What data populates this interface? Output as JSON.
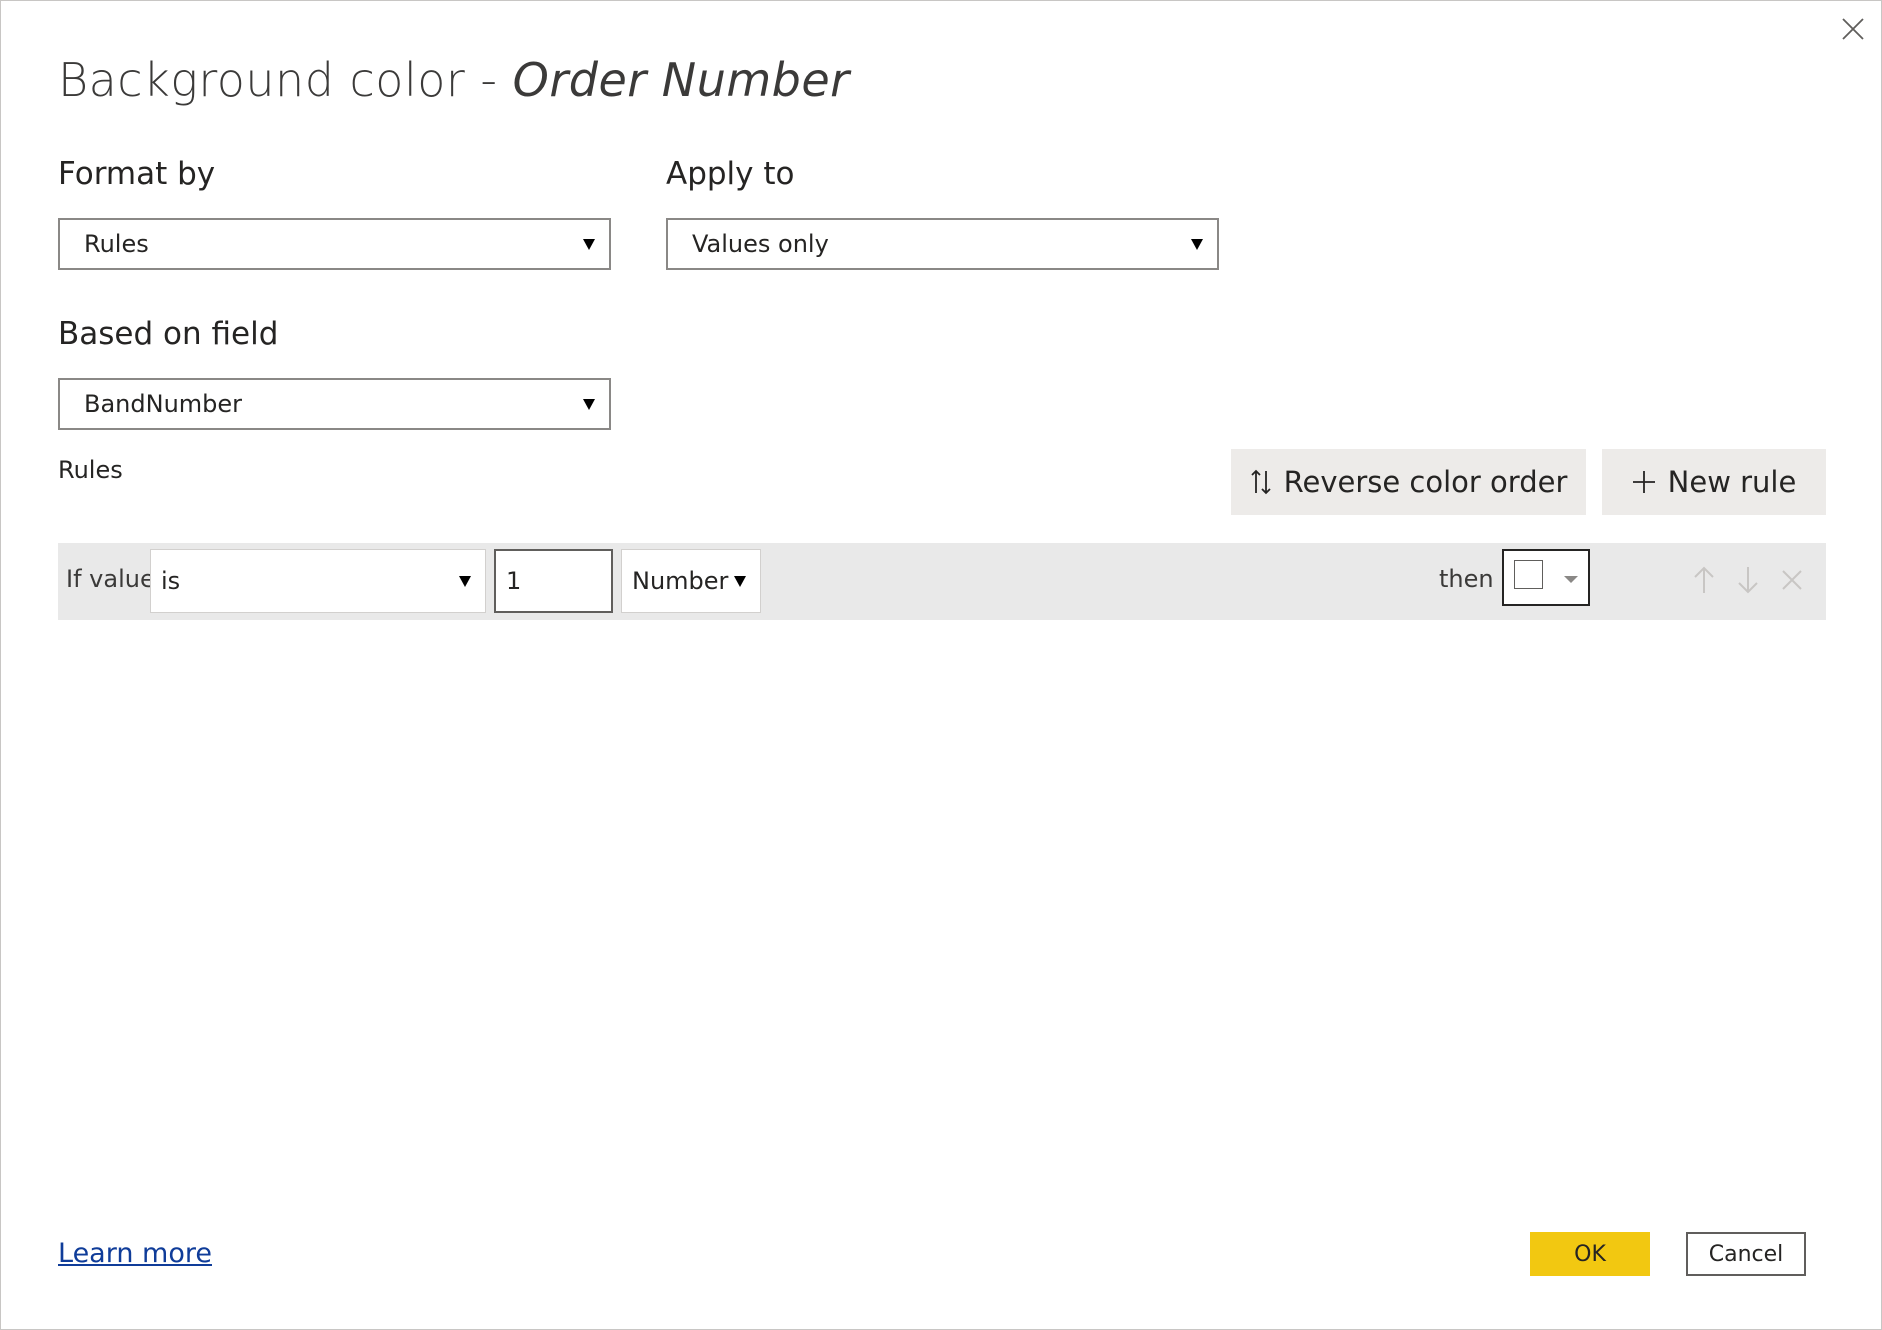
{
  "dialog": {
    "title_prefix": "Background color - ",
    "title_field": "Order Number",
    "close_icon": "close-icon"
  },
  "format_by": {
    "label": "Format by",
    "value": "Rules"
  },
  "apply_to": {
    "label": "Apply to",
    "value": "Values only"
  },
  "based_on_field": {
    "label": "Based on field",
    "value": "BandNumber"
  },
  "rules": {
    "label": "Rules",
    "reverse_button": "Reverse color order",
    "new_rule_button": "New rule",
    "rows": [
      {
        "if_value_label": "If value",
        "operator": "is",
        "value": "1",
        "type": "Number",
        "then_label": "then",
        "color": "#ffffff"
      }
    ]
  },
  "footer": {
    "learn_more": "Learn more",
    "ok": "OK",
    "cancel": "Cancel"
  },
  "colors": {
    "accent_ok": "#f2c811",
    "row_background": "#e9e9e9",
    "link": "#0f3c99"
  }
}
